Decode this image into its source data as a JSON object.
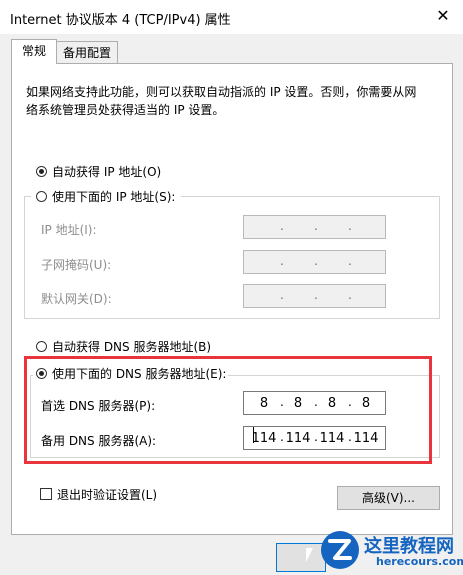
{
  "window": {
    "title": "Internet 协议版本 4 (TCP/IPv4) 属性"
  },
  "tabs": [
    {
      "label": "常规"
    },
    {
      "label": "备用配置"
    }
  ],
  "general": {
    "description_line1": "如果网络支持此功能，则可以获取自动指派的 IP 设置。否则，你需要从网",
    "description_line2": "络系统管理员处获得适当的 IP 设置。",
    "auto_ip_label": "自动获得 IP 地址(O)",
    "manual_ip_label": "使用下面的 IP 地址(S):",
    "ip_address_label": "IP 地址(I):",
    "subnet_label": "子网掩码(U):",
    "gateway_label": "默认网关(D):",
    "auto_dns_label": "自动获得 DNS 服务器地址(B)",
    "manual_dns_label": "使用下面的 DNS 服务器地址(E):",
    "preferred_dns_label": "首选 DNS 服务器(P):",
    "alternate_dns_label": "备用 DNS 服务器(A):",
    "preferred_dns": [
      "8",
      "8",
      "8",
      "8"
    ],
    "alternate_dns": [
      "114",
      "114",
      "114",
      "114"
    ],
    "validate_label": "退出时验证设置(L)",
    "advanced_button": "高级(V)...",
    "ip_selected": "auto",
    "dns_selected": "manual"
  },
  "watermark": {
    "name": "这里教程网",
    "url": "herecours.com"
  },
  "colors": {
    "highlight_border": "#e8353d",
    "watermark_blue": "#1565c0"
  }
}
